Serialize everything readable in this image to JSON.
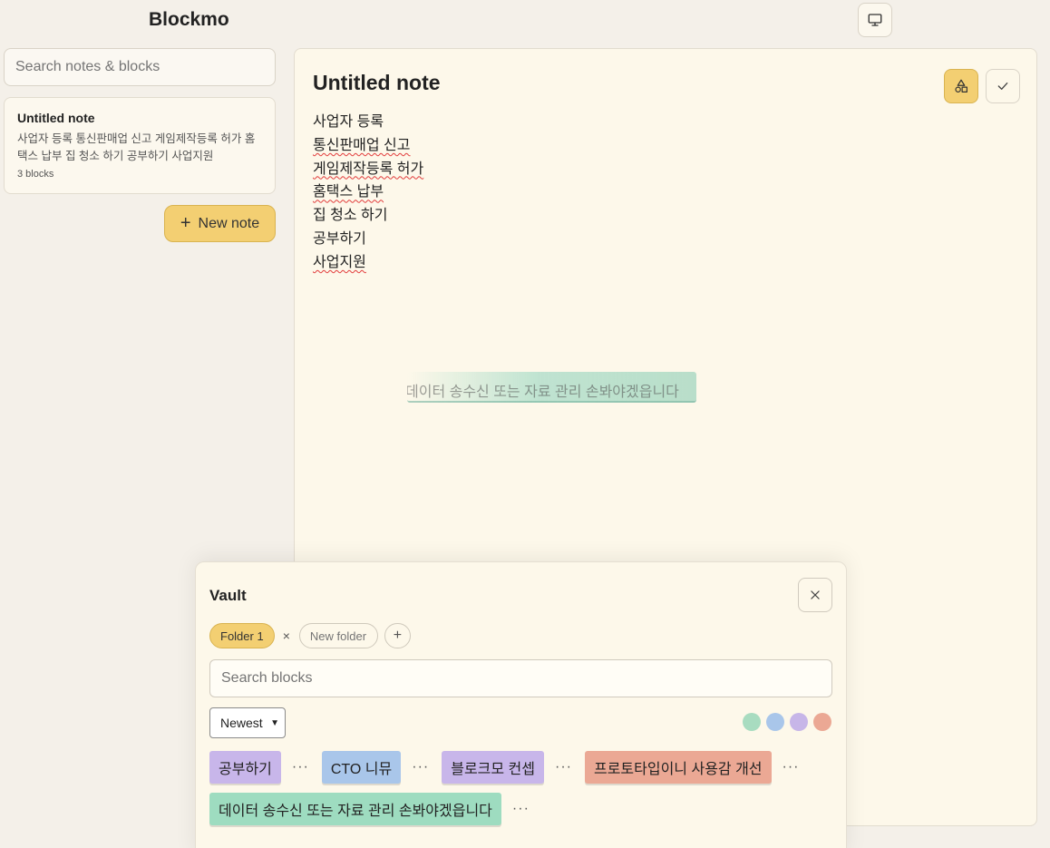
{
  "app": {
    "title": "Blockmo"
  },
  "sidebar": {
    "search_placeholder": "Search notes & blocks",
    "notes": [
      {
        "title": "Untitled note",
        "preview": "사업자 등록 통신판매업 신고 게임제작등록 허가 홈택스 납부 집 청소 하기 공부하기 사업지원",
        "count": "3 blocks"
      }
    ],
    "new_note_label": "New note"
  },
  "editor": {
    "title": "Untitled note",
    "lines": [
      "사업자 등록",
      "통신판매업 신고",
      "게임제작등록 허가",
      "홈택스 납부",
      "집 청소 하기",
      "공부하기",
      "사업지원"
    ],
    "dragging_block": "데이터 송수신 또는 자료 관리 손봐야겠읍니다"
  },
  "vault": {
    "title": "Vault",
    "folders": [
      {
        "label": "Folder 1",
        "active": true
      }
    ],
    "folder_remove": "×",
    "new_folder_placeholder": "New folder",
    "add_folder": "+",
    "search_placeholder": "Search blocks",
    "sort": "Newest",
    "filter_colors": [
      "#a8dcc0",
      "#a9c6ea",
      "#c7b6e8",
      "#eba894"
    ],
    "more_label": "···",
    "blocks": [
      {
        "text": "공부하기",
        "color": "#c8b6ea"
      },
      {
        "text": "CTO 니뮤",
        "color": "#a9c6ea"
      },
      {
        "text": "블로크모 컨셉",
        "color": "#c8b6ea"
      },
      {
        "text": "프로토타입이니 사용감 개선",
        "color": "#eba894"
      },
      {
        "text": "데이터 송수신 또는 자료 관리 손봐야겠읍니다",
        "color": "#9edcc0"
      }
    ]
  },
  "icons": {
    "present": "monitor-icon",
    "shapes": "shapes-icon",
    "check": "check-icon",
    "close": "close-icon",
    "plus": "plus-icon"
  }
}
